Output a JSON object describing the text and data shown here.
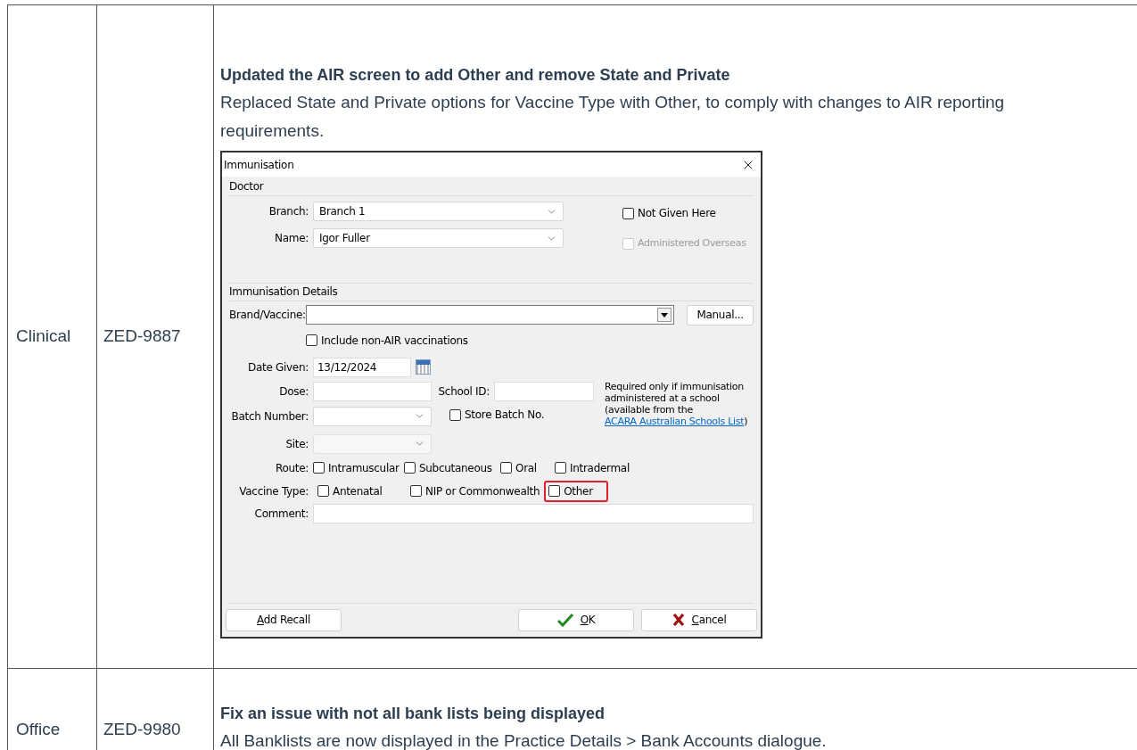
{
  "rows": [
    {
      "category": "Clinical",
      "ticket": "ZED-9887",
      "title": "Updated the AIR screen to add Other and remove State and Private",
      "description": "Replaced State and Private options for Vaccine Type with Other, to comply with changes to AIR reporting requirements.",
      "dialog": {
        "title": "Immunisation",
        "doctor": {
          "legend": "Doctor",
          "branch": {
            "label": "Branch:",
            "value": "Branch 1"
          },
          "name": {
            "label": "Name:",
            "value": "Igor Fuller"
          },
          "flags": [
            {
              "label": "Not Given Here",
              "checked": false,
              "disabled": false
            },
            {
              "label": "Administered Overseas",
              "checked": false,
              "disabled": true
            }
          ]
        },
        "details": {
          "legend": "Immunisation Details",
          "brand": {
            "label": "Brand/Vaccine:"
          },
          "manual_button": "Manual...",
          "include_non_air": {
            "label": "Include non-AIR vaccinations",
            "checked": false
          },
          "date_given": {
            "label": "Date Given:",
            "value": "13/12/2024"
          },
          "dose": {
            "label": "Dose:"
          },
          "school_id": {
            "label": "School ID:"
          },
          "school_note": {
            "text": "Required only if immunisation administered at a school (available from the",
            "link": "ACARA Australian Schools List",
            "suffix": ")"
          },
          "batch_number": {
            "label": "Batch Number:"
          },
          "store_batch": {
            "label": "Store Batch No.",
            "checked": false
          },
          "site": {
            "label": "Site:"
          },
          "route": {
            "label": "Route:",
            "options": [
              {
                "label": "Intramuscular",
                "checked": false
              },
              {
                "label": "Subcutaneous",
                "checked": false
              },
              {
                "label": "Oral",
                "checked": false
              },
              {
                "label": "Intradermal",
                "checked": false
              }
            ]
          },
          "vaccine_type": {
            "label": "Vaccine Type:",
            "options": [
              {
                "label": "Antenatal",
                "checked": false,
                "highlighted": false
              },
              {
                "label": "NIP or Commonwealth",
                "checked": false,
                "highlighted": false
              },
              {
                "label": "Other",
                "checked": false,
                "highlighted": true
              }
            ]
          },
          "comment": {
            "label": "Comment:"
          }
        },
        "buttons": [
          {
            "label": "Add Recall",
            "kind": "plain"
          },
          {
            "label": "OK",
            "kind": "ok"
          },
          {
            "label": "Cancel",
            "kind": "cancel"
          }
        ]
      }
    },
    {
      "category": "Office",
      "ticket": "ZED-9980",
      "title": "Fix an issue with not all bank lists being displayed",
      "description": "All Banklists are now displayed in the Practice Details > Bank Accounts dialogue."
    }
  ]
}
